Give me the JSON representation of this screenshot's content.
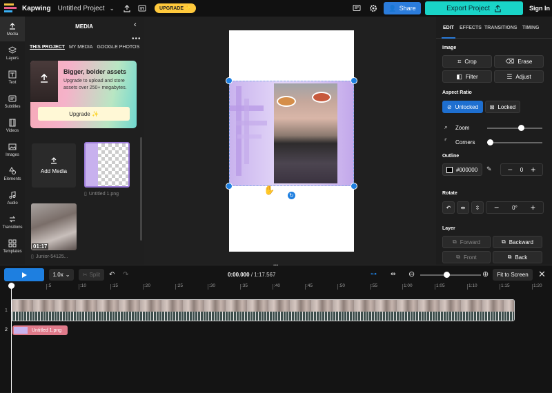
{
  "topbar": {
    "brand": "Kapwing",
    "project_title": "Untitled Project",
    "upgrade_pill": "UPGRADE ✨",
    "share": "Share",
    "export": "Export Project",
    "signin": "Sign In"
  },
  "rail": {
    "items": [
      "Media",
      "Layers",
      "Text",
      "Subtitles",
      "Videos",
      "Images",
      "Elements",
      "Audio",
      "Transitions",
      "Templates"
    ]
  },
  "media": {
    "title": "MEDIA",
    "tabs": [
      "THIS PROJECT",
      "MY MEDIA",
      "GOOGLE PHOTOS"
    ],
    "promo_title": "Bigger, bolder assets",
    "promo_text": "Upgrade to upload and store assets over 250+ megabytes.",
    "promo_button": "Upgrade ✨",
    "add_media": "Add Media",
    "item1_name": "Untitled 1.png",
    "item2_duration": "01:17",
    "item2_name": "Junior-54125..."
  },
  "props": {
    "tabs": [
      "EDIT",
      "EFFECTS",
      "TRANSITIONS",
      "TIMING"
    ],
    "image_label": "Image",
    "crop": "Crop",
    "erase": "Erase",
    "filter": "Filter",
    "adjust": "Adjust",
    "aspect_label": "Aspect Ratio",
    "unlocked": "Unlocked",
    "locked": "Locked",
    "zoom": "Zoom",
    "corners": "Corners",
    "outline_label": "Outline",
    "outline_color": "#000000",
    "outline_value": "0",
    "rotate_label": "Rotate",
    "rotate_value": "0°",
    "layer_label": "Layer",
    "forward": "Forward",
    "backward": "Backward",
    "front": "Front",
    "back": "Back",
    "zoom_level": 0.62,
    "corners_level": 0.0
  },
  "timeline": {
    "speed": "1.0x",
    "split": "Split",
    "current_time": "0:00.000",
    "total_time": "/ 1:17.567",
    "fit": "Fit to Screen",
    "ticks": [
      "0",
      ":5",
      ":10",
      ":15",
      ":20",
      ":25",
      ":30",
      ":35",
      ":40",
      ":45",
      ":50",
      ":55",
      "1:00",
      "1:05",
      "1:10",
      "1:15",
      "1:20"
    ],
    "track1_num": "1",
    "track2_num": "2",
    "track2_label": "Untitled 1.png"
  },
  "colors": {
    "accent": "#1e7fe0",
    "export": "#19d4c7",
    "upgrade": "#ffc93c",
    "clip2": "#e07a8a"
  }
}
